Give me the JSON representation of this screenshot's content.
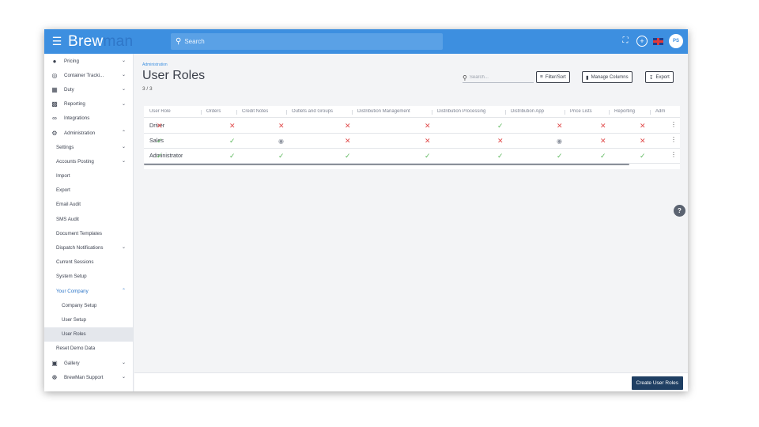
{
  "brand": {
    "part1": "Brew",
    "part2": "man"
  },
  "search": {
    "placeholder": "Search"
  },
  "user": {
    "initials": "PS"
  },
  "sidebar": {
    "items": [
      {
        "label": "Pricing",
        "icon": "pricing-icon"
      },
      {
        "label": "Container Tracki...",
        "icon": "container-icon"
      },
      {
        "label": "Duty",
        "icon": "duty-icon"
      },
      {
        "label": "Reporting",
        "icon": "reporting-icon"
      },
      {
        "label": "Integrations",
        "icon": "integrations-icon"
      },
      {
        "label": "Administration",
        "icon": "gear-icon"
      },
      {
        "label": "Settings"
      },
      {
        "label": "Accounts Posting"
      },
      {
        "label": "Import"
      },
      {
        "label": "Export"
      },
      {
        "label": "Email Audit"
      },
      {
        "label": "SMS Audit"
      },
      {
        "label": "Document Templates"
      },
      {
        "label": "Dispatch Notifications"
      },
      {
        "label": "Current Sessions"
      },
      {
        "label": "System Setup"
      },
      {
        "label": "Your Company"
      },
      {
        "label": "Company Setup"
      },
      {
        "label": "User Setup"
      },
      {
        "label": "User Roles"
      },
      {
        "label": "Reset Demo Data"
      },
      {
        "label": "Gallery",
        "icon": "gallery-icon"
      },
      {
        "label": "BrewMan Support",
        "icon": "support-icon"
      }
    ]
  },
  "page": {
    "breadcrumb": "Administration",
    "title": "User Roles",
    "count": "3 / 3",
    "search_placeholder": "Search...",
    "filter_label": "Filter/Sort",
    "columns_label": "Manage Columns",
    "export_label": "Export",
    "create_label": "Create User Roles"
  },
  "table": {
    "headers": [
      "User Role",
      "Orders",
      "Credit Notes",
      "Outlets and Groups",
      "Distribution Management",
      "Distribution Processing",
      "Distribution App",
      "Price Lists",
      "Reporting",
      "Adm"
    ],
    "rows": [
      {
        "name": "Driver",
        "values": [
          "no",
          "no",
          "no",
          "no",
          "no",
          "yes",
          "no",
          "no",
          "no"
        ]
      },
      {
        "name": "Sales",
        "values": [
          "yes",
          "yes",
          "view",
          "no",
          "no",
          "no",
          "view",
          "no",
          "no"
        ]
      },
      {
        "name": "Administrator",
        "values": [
          "yes",
          "yes",
          "yes",
          "yes",
          "yes",
          "yes",
          "yes",
          "yes",
          "yes"
        ]
      }
    ]
  },
  "colors": {
    "topbar": "#3d8fe0",
    "accent": "#2f77c8",
    "deny": "#e04a4a",
    "allow": "#5cb85c",
    "primary_button": "#1f3f63"
  }
}
